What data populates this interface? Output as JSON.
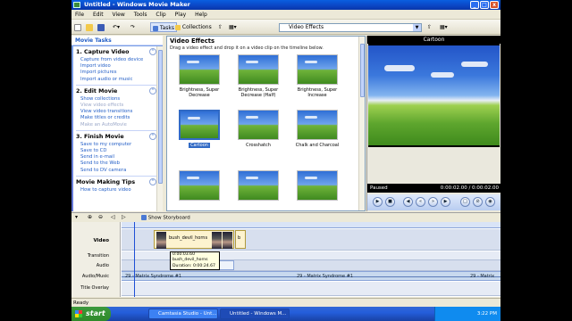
{
  "window": {
    "title": "Untitled - Windows Movie Maker",
    "min": "_",
    "max": "□",
    "close": "x"
  },
  "menu": [
    "File",
    "Edit",
    "View",
    "Tools",
    "Clip",
    "Play",
    "Help"
  ],
  "toolbar": {
    "tasks_label": "Tasks",
    "collections_label": "Collections",
    "collection_combo": "Video Effects"
  },
  "tasks": {
    "header": "Movie Tasks",
    "sections": [
      {
        "title": "1. Capture Video",
        "links": [
          "Capture from video device",
          "Import video",
          "Import pictures",
          "Import audio or music"
        ]
      },
      {
        "title": "2. Edit Movie",
        "links": [
          "Show collections",
          "View video effects",
          "View video transitions",
          "Make titles or credits",
          "Make an AutoMovie"
        ]
      },
      {
        "title": "3. Finish Movie",
        "links": [
          "Save to my computer",
          "Save to CD",
          "Send in e-mail",
          "Send to the Web",
          "Send to DV camera"
        ]
      },
      {
        "title": "Movie Making Tips",
        "links": [
          "How to capture video"
        ]
      }
    ]
  },
  "collection": {
    "title": "Video Effects",
    "subtitle": "Drag a video effect and drop it on a video clip on the timeline below.",
    "effects": [
      "Brightness, Super Decrease",
      "Brightness, Super Decrease (Half)",
      "Brightness, Super Increase",
      "Cartoon",
      "Crosshatch",
      "Chalk and Charcoal",
      "",
      "",
      ""
    ],
    "selected": "Cartoon"
  },
  "preview": {
    "title": "Cartoon",
    "status": "Paused",
    "time": "0:00:02.00 / 0:00:02.00"
  },
  "timeline": {
    "storyboard_label": "Show Storyboard",
    "tracks": [
      "Video",
      "Transition",
      "Audio",
      "Audio/Music",
      "Title Overlay"
    ],
    "clip_name": "bush_devil_horns",
    "clip_short": "b",
    "tooltip": [
      "0:00:03.60",
      "bush_devil_horns",
      "Duration: 0:00:24.67"
    ],
    "audio_labels": [
      "29 - Matrix Syndrome #1",
      "29 - Matrix Syndrome #1",
      "29 - Matrix"
    ]
  },
  "status": "Ready",
  "taskbar": {
    "start": "start",
    "items": [
      "Camtasia Studio - Unt...",
      "Untitled - Windows M..."
    ],
    "clock": "3:22 PM"
  },
  "colors": {
    "title_blue": "#0b45c4",
    "link_blue": "#215dc6",
    "selection": "#316ac5"
  }
}
